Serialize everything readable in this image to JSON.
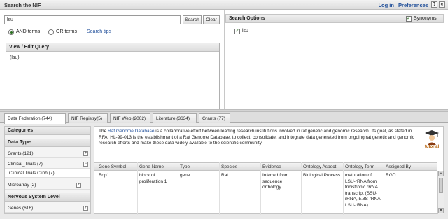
{
  "header": {
    "title": "Search the NIF",
    "login": "Log in",
    "preferences": "Preferences",
    "help_icon": "?",
    "collapse_icon": "«"
  },
  "search": {
    "value": "lsu",
    "search_button": "Search",
    "clear_button": "Clear",
    "and_label": "AND terms",
    "or_label": "OR terms",
    "search_tips": "Search tips",
    "view_edit_title": "View / Edit Query",
    "query_text": "(lsu)"
  },
  "options": {
    "title": "Search Options",
    "synonyms": "Synonyms",
    "term": "lsu"
  },
  "tabs": [
    "Data Federation (744)",
    "NIF Registry(5)",
    "NIF Web (2002)",
    "Literature (3634)",
    "Grants (77)"
  ],
  "categories": {
    "title": "Categories",
    "data_type": "Data Type",
    "items": [
      "Grants (121)",
      "Clinical_Trials (7)",
      "Clinical Trials Clinh (7)",
      "Microarray (2)"
    ],
    "nervous_system": "Nervous System Level",
    "genes": "Genes (616)"
  },
  "intro": {
    "prefix": "The ",
    "link": "Rat Genome Database",
    "text": " is a collaborative effort between leading research institutions involved in rat genetic and genomic research. Its goal, as stated in RFA: HL-99-013 is the establishment of a Rat Genome Database, to collect, consolidate, and integrate data generated from ongoing rat genetic and genomic research efforts and make these data widely available to the scientific community.",
    "tutorial": "tutorial"
  },
  "table": {
    "columns": [
      "Gene Symbol",
      "Gene Name",
      "Type",
      "Species",
      "Evidence",
      "Ontology Aspect",
      "Ontology Term",
      "Assigned By"
    ],
    "row": {
      "gene_symbol": "Bop1",
      "gene_name": "block of proliferation 1",
      "type": "gene",
      "species": "Rat",
      "evidence": "Inferred from sequence orthology",
      "ontology_aspect": "Biological Process",
      "ontology_term": "maturation of LSU-rRNA from tricistronic rRNA transcript (SSU-rRNA, 5.8S rRNA, LSU-rRNA)",
      "assigned_by": "RGD"
    }
  },
  "colors": {
    "link": "#1f4e99",
    "accent_green": "#2a6e1f"
  }
}
